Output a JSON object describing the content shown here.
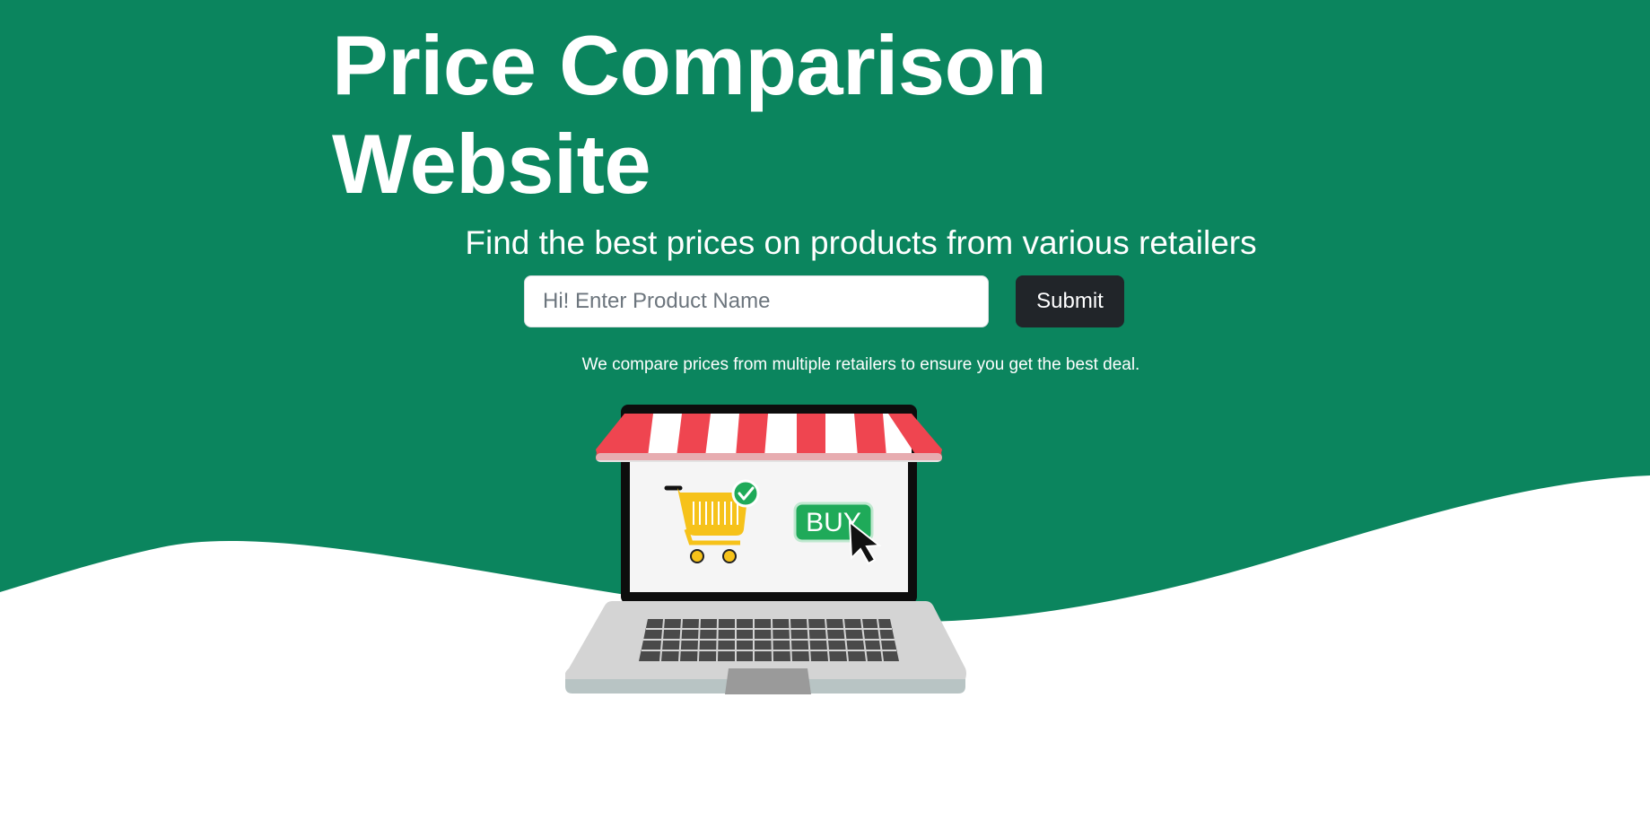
{
  "hero": {
    "title": "Price Comparison Website",
    "subtitle": "Find the best prices on products from various retailers",
    "note": "We compare prices from multiple retailers to ensure you get the best deal."
  },
  "search": {
    "placeholder": "Hi! Enter Product Name",
    "value": "",
    "submit_label": "Submit"
  },
  "illustration": {
    "buy_label": "BUY"
  },
  "colors": {
    "brand_green": "#0b855e",
    "button_dark": "#212529",
    "awning_red": "#ef4550",
    "cart_yellow": "#f6c21a",
    "buy_green": "#1faa59"
  },
  "icons": [
    "shopping-cart-icon",
    "check-badge-icon",
    "cursor-arrow-icon"
  ]
}
